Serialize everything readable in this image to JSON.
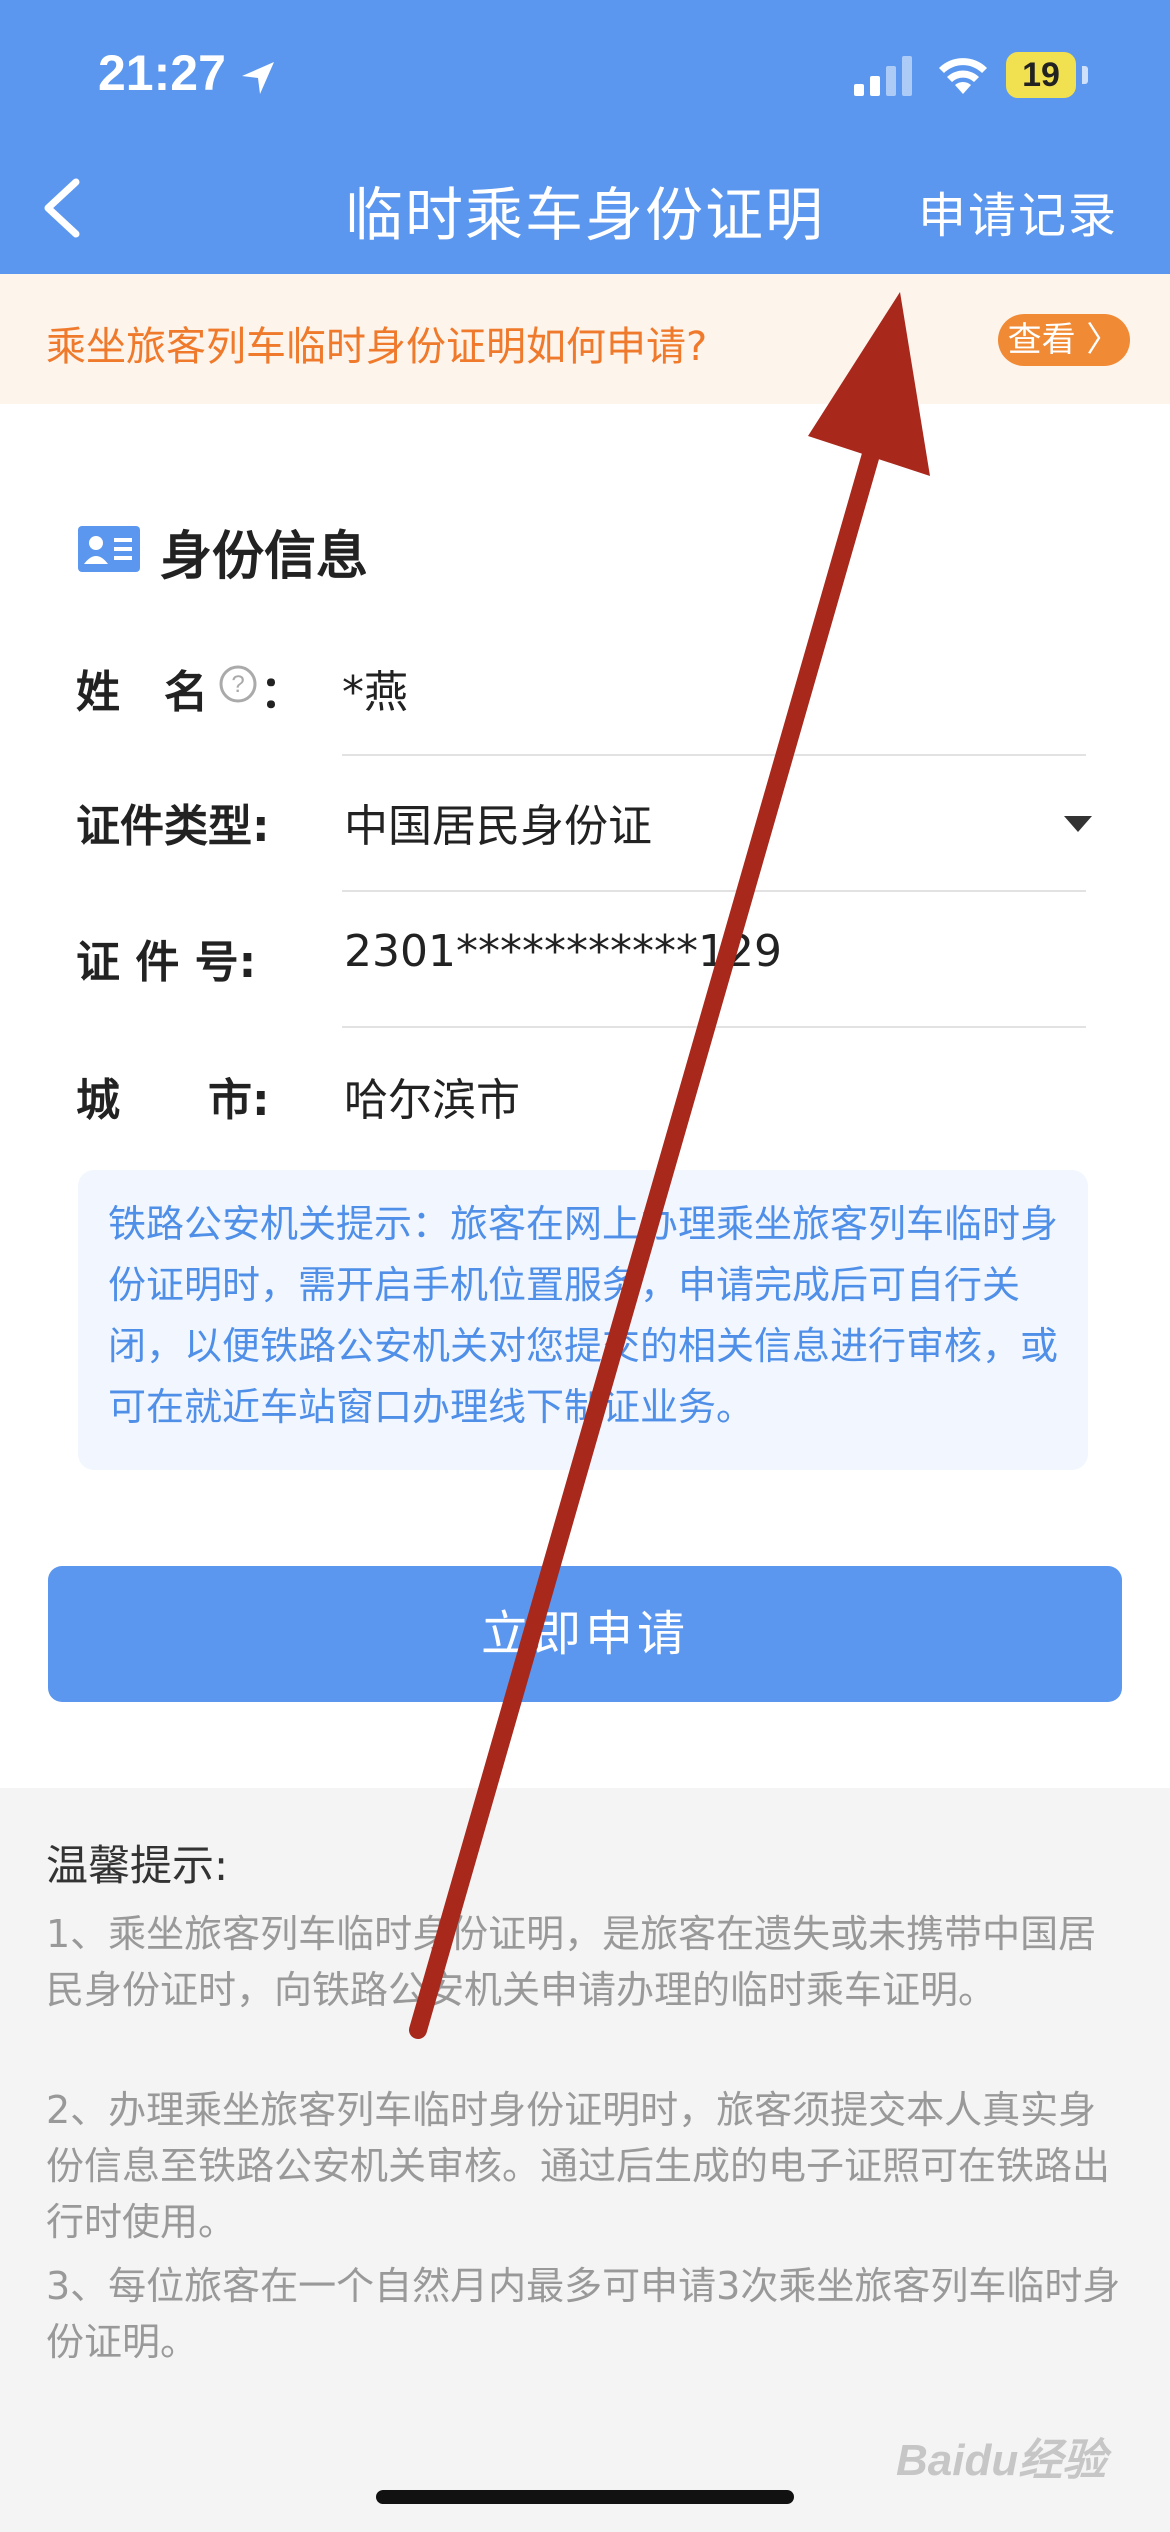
{
  "status_bar": {
    "time": "21:27",
    "battery": "19"
  },
  "nav": {
    "title": "临时乘车身份证明",
    "record": "申请记录"
  },
  "notice": {
    "text": "乘坐旅客列车临时身份证明如何申请?",
    "button": "查看 〉"
  },
  "card": {
    "title": "身份信息",
    "name_label": "姓　名",
    "name_colon": "：",
    "name_value": "*燕",
    "id_type_label": "证件类型:",
    "id_type_value": "中国居民身份证",
    "id_no_label": "证 件 号:",
    "id_no_value": "2301***********129",
    "city_label": "城　　市:",
    "city_value": "哈尔滨市",
    "tip": "铁路公安机关提示：旅客在网上办理乘坐旅客列车临时身份证明时，需开启手机位置服务，申请完成后可自行关闭，以便铁路公安机关对您提交的相关信息进行审核，或可在就近车站窗口办理线下制证业务。"
  },
  "apply_button": "立即申请",
  "tips": {
    "title": "温馨提示:",
    "items": [
      "1、乘坐旅客列车临时身份证明，是旅客在遗失或未携带中国居民身份证时，向铁路公安机关申请办理的临时乘车证明。",
      "2、办理乘坐旅客列车临时身份证明时，旅客须提交本人真实身份信息至铁路公安机关审核。通过后生成的电子证照可在铁路出行时使用。",
      "3、每位旅客在一个自然月内最多可申请3次乘坐旅客列车临时身份证明。"
    ]
  },
  "watermark": "Baidu经验",
  "colors": {
    "primary": "#5b97ee",
    "orange": "#ef7a2c",
    "arrow": "#a8281c"
  },
  "icons": [
    "location-arrow-icon",
    "signal-icon",
    "wifi-icon",
    "back-chevron-icon",
    "id-card-icon",
    "help-icon",
    "dropdown-caret-icon"
  ]
}
